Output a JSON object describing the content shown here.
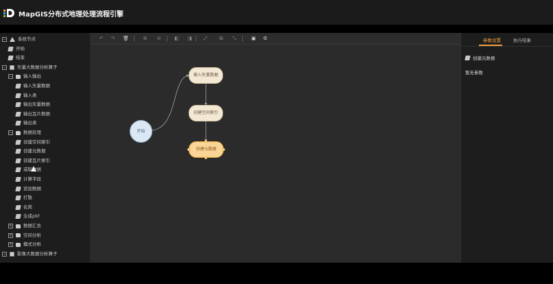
{
  "app": {
    "title": "MapGIS分布式地理处理流程引擎"
  },
  "sidebar": {
    "items": [
      {
        "label": "系统节点",
        "level": 0,
        "toggle": "−",
        "icon": "home-icon"
      },
      {
        "label": "开始",
        "level": 1,
        "toggle": "",
        "icon": "node-icon"
      },
      {
        "label": "结束",
        "level": 1,
        "toggle": "",
        "icon": "node-icon"
      },
      {
        "label": "矢量大数据分析算子",
        "level": 0,
        "toggle": "−",
        "icon": "image-icon"
      },
      {
        "label": "输入输出",
        "level": 1,
        "toggle": "−",
        "icon": "folder-icon"
      },
      {
        "label": "输入矢量数据",
        "level": 2,
        "toggle": "",
        "icon": "node-icon"
      },
      {
        "label": "输入表",
        "level": 2,
        "toggle": "",
        "icon": "node-icon"
      },
      {
        "label": "输出矢量数据",
        "level": 2,
        "toggle": "",
        "icon": "node-icon"
      },
      {
        "label": "输出瓦片数据",
        "level": 2,
        "toggle": "",
        "icon": "node-icon"
      },
      {
        "label": "输出表",
        "level": 2,
        "toggle": "",
        "icon": "node-icon"
      },
      {
        "label": "数据处理",
        "level": 1,
        "toggle": "−",
        "icon": "folder-icon"
      },
      {
        "label": "创建空间索引",
        "level": 2,
        "toggle": "",
        "icon": "node-icon"
      },
      {
        "label": "创建元数据",
        "level": 2,
        "toggle": "",
        "icon": "node-icon"
      },
      {
        "label": "创建瓦片索引",
        "level": 2,
        "toggle": "",
        "icon": "node-icon"
      },
      {
        "label": "或取数据",
        "level": 2,
        "toggle": "",
        "icon": "node-icon"
      },
      {
        "label": "计算字段",
        "level": 2,
        "toggle": "",
        "icon": "node-icon"
      },
      {
        "label": "追加数据",
        "level": 2,
        "toggle": "",
        "icon": "node-icon"
      },
      {
        "label": "打散",
        "level": 2,
        "toggle": "",
        "icon": "node-icon"
      },
      {
        "label": "化简",
        "level": 2,
        "toggle": "",
        "icon": "node-icon"
      },
      {
        "label": "生成pbf",
        "level": 2,
        "toggle": "",
        "icon": "node-icon"
      },
      {
        "label": "数据汇总",
        "level": 1,
        "toggle": "+",
        "icon": "folder-icon"
      },
      {
        "label": "空间分析",
        "level": 1,
        "toggle": "+",
        "icon": "folder-icon"
      },
      {
        "label": "模式分析",
        "level": 1,
        "toggle": "+",
        "icon": "folder-icon"
      },
      {
        "label": "影像大数据分析算子",
        "level": 0,
        "toggle": "−",
        "icon": "image-icon"
      }
    ]
  },
  "toolbar": {
    "tools": [
      {
        "name": "undo-icon",
        "glyph": "↶",
        "active": false
      },
      {
        "name": "redo-icon",
        "glyph": "↷",
        "active": false
      },
      {
        "name": "delete-icon",
        "glyph": "🗑",
        "active": true
      },
      {
        "name": "zoom-in-icon",
        "glyph": "⊕",
        "active": false
      },
      {
        "name": "zoom-out-icon",
        "glyph": "⊖",
        "active": false
      },
      {
        "name": "bring-front-icon",
        "glyph": "◧",
        "active": false
      },
      {
        "name": "send-back-icon",
        "glyph": "◨",
        "active": false
      },
      {
        "name": "fit-icon",
        "glyph": "⤢",
        "active": false
      },
      {
        "name": "actual-size-icon",
        "glyph": "⊞",
        "active": false
      },
      {
        "name": "autolayout-icon",
        "glyph": "⤡",
        "active": false
      },
      {
        "name": "save-icon",
        "glyph": "▣",
        "active": true
      },
      {
        "name": "settings-icon",
        "glyph": "⚙",
        "active": true
      }
    ]
  },
  "canvas": {
    "start": "开始",
    "nodes": [
      "输入矢量数据",
      "创建空间索引",
      "创建元数据"
    ]
  },
  "right_panel": {
    "tabs": [
      "参数设置",
      "执行结果"
    ],
    "active_tab": 0,
    "node_title": "创建元数据",
    "empty_text": "暂无参数"
  },
  "colors": {
    "accent": "#f0a23c",
    "node_fill": "#f3e8d4",
    "selected_fill": "#f9d598",
    "start_fill": "#dbe7f3"
  }
}
